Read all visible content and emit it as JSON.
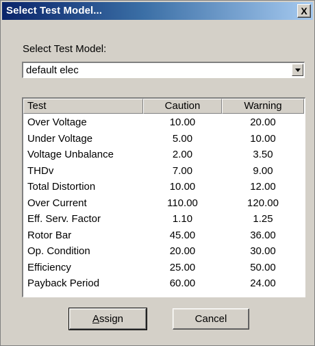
{
  "window": {
    "title": "Select Test Model...",
    "close_glyph": "X"
  },
  "form": {
    "label": "Select Test Model:",
    "selected_model": "default elec"
  },
  "table": {
    "headers": {
      "test": "Test",
      "caution": "Caution",
      "warning": "Warning"
    },
    "rows": [
      {
        "test": "Over Voltage",
        "caution": "10.00",
        "warning": "20.00"
      },
      {
        "test": "Under Voltage",
        "caution": "5.00",
        "warning": "10.00"
      },
      {
        "test": "Voltage Unbalance",
        "caution": "2.00",
        "warning": "3.50"
      },
      {
        "test": "THDv",
        "caution": "7.00",
        "warning": "9.00"
      },
      {
        "test": "Total Distortion",
        "caution": "10.00",
        "warning": "12.00"
      },
      {
        "test": "Over Current",
        "caution": "110.00",
        "warning": "120.00"
      },
      {
        "test": "Eff. Serv. Factor",
        "caution": "1.10",
        "warning": "1.25"
      },
      {
        "test": "Rotor Bar",
        "caution": "45.00",
        "warning": "36.00"
      },
      {
        "test": "Op. Condition",
        "caution": "20.00",
        "warning": "30.00"
      },
      {
        "test": "Efficiency",
        "caution": "25.00",
        "warning": "50.00"
      },
      {
        "test": "Payback Period",
        "caution": "60.00",
        "warning": "24.00"
      }
    ]
  },
  "buttons": {
    "assign_mnemonic": "A",
    "assign_rest": "ssign",
    "cancel": "Cancel"
  },
  "colors": {
    "titlebar_start": "#0a246a",
    "titlebar_end": "#a6caf0",
    "face": "#d4d0c8"
  }
}
